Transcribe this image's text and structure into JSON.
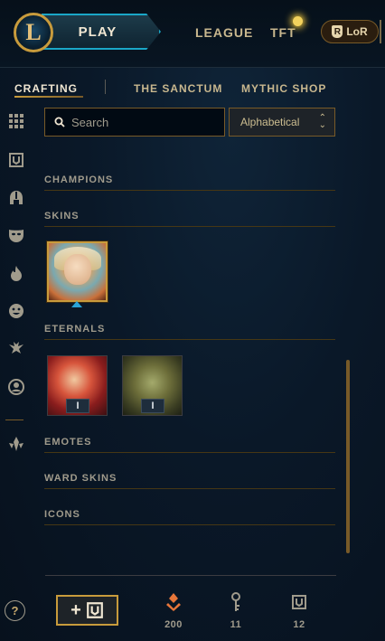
{
  "header": {
    "logo_letter": "L",
    "play_label": "PLAY",
    "nav": [
      "LEAGUE",
      "TFT"
    ],
    "lor_label": "LoR",
    "lor_icon_letter": "R"
  },
  "subnav": {
    "tabs": [
      "CRAFTING",
      "THE SANCTUM",
      "MYTHIC SHOP"
    ]
  },
  "sidebar": {
    "icons": [
      "grid-icon",
      "chest-icon",
      "helmet-icon",
      "mask-icon",
      "flame-icon",
      "emote-icon",
      "ward-icon",
      "profile-icon",
      "tft-icon"
    ]
  },
  "search": {
    "placeholder": "Search"
  },
  "sort": {
    "selected": "Alphabetical"
  },
  "sections": [
    "CHAMPIONS",
    "SKINS",
    "ETERNALS",
    "EMOTES",
    "WARD SKINS",
    "ICONS"
  ],
  "eternals": [
    {
      "badge": "I"
    },
    {
      "badge": "I"
    }
  ],
  "footer": {
    "help_label": "?",
    "add_label": "+",
    "currencies": [
      {
        "icon": "orange-essence-icon",
        "value": "200",
        "color": "#e8763a"
      },
      {
        "icon": "key-icon",
        "value": "11",
        "color": "#a09b8c"
      },
      {
        "icon": "chest-icon",
        "value": "12",
        "color": "#a09b8c"
      }
    ]
  },
  "colors": {
    "gold": "#c89b3c",
    "accent_blue": "#1aa7c7",
    "orange_essence": "#e8763a"
  }
}
